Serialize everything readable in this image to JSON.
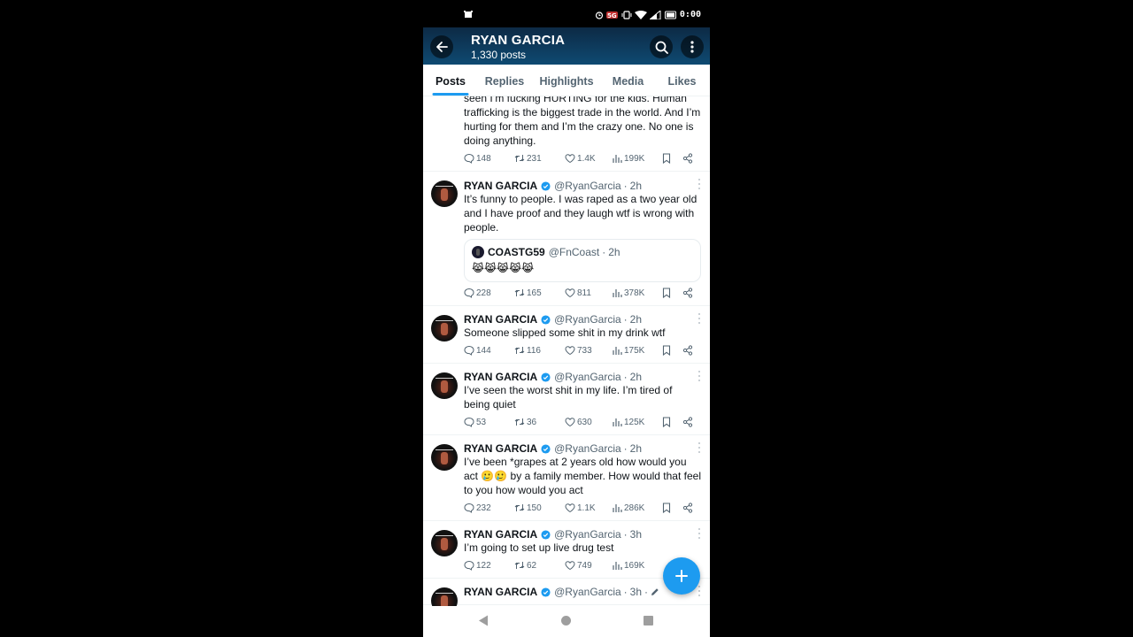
{
  "status_bar": {
    "time": "0:00",
    "left_icon": "notification-icon",
    "right_icons": [
      "alarm-icon",
      "data-icon",
      "vibrate-icon",
      "wifi-icon",
      "signal-icon",
      "battery-icon"
    ]
  },
  "header": {
    "title": "RYAN GARCIA",
    "subtitle": "1,330 posts",
    "back_icon": "arrow-left-icon",
    "search_icon": "search-icon",
    "more_icon": "more-vertical-icon"
  },
  "tabs": [
    {
      "label": "Posts",
      "active": true
    },
    {
      "label": "Replies",
      "active": false
    },
    {
      "label": "Highlights",
      "active": false
    },
    {
      "label": "Media",
      "active": false
    },
    {
      "label": "Likes",
      "active": false
    }
  ],
  "colors": {
    "accent": "#1d9bf0",
    "text_primary": "#0f1419",
    "text_secondary": "#536471",
    "header_top": "#0d2a45",
    "header_bottom": "#0e4a72"
  },
  "tweets": [
    {
      "partial": true,
      "text": "seen I’m fucking HURTING for the kids. Human trafficking is the biggest trade in the world. And I’m hurting for them and I’m the crazy one. No one is doing anything.",
      "replies": "148",
      "retweets": "231",
      "likes": "1.4K",
      "views": "199K"
    },
    {
      "name": "RYAN GARCIA",
      "handle": "@RyanGarcia",
      "time": "2h",
      "text": "It’s funny to people. I was raped as a two year old and I have proof and they laugh wtf is wrong with people.",
      "quote": {
        "name": "COASTG59",
        "handle": "@FnCoast",
        "time": "2h",
        "text": "😹😹😹😹😹"
      },
      "replies": "228",
      "retweets": "165",
      "likes": "811",
      "views": "378K"
    },
    {
      "name": "RYAN GARCIA",
      "handle": "@RyanGarcia",
      "time": "2h",
      "text": "Someone slipped some shit in my drink wtf",
      "replies": "144",
      "retweets": "116",
      "likes": "733",
      "views": "175K"
    },
    {
      "name": "RYAN GARCIA",
      "handle": "@RyanGarcia",
      "time": "2h",
      "text": "I’ve seen the worst shit in my life. I’m tired of being quiet",
      "replies": "53",
      "retweets": "36",
      "likes": "630",
      "views": "125K"
    },
    {
      "name": "RYAN GARCIA",
      "handle": "@RyanGarcia",
      "time": "2h",
      "text": "I’ve been *grapes at 2 years old how would you act 🥲🥲 by a family member. How would that feel to you how would you act",
      "replies": "232",
      "retweets": "150",
      "likes": "1.1K",
      "views": "286K"
    },
    {
      "name": "RYAN GARCIA",
      "handle": "@RyanGarcia",
      "time": "3h",
      "text": "I’m going to set up live drug test",
      "replies": "122",
      "retweets": "62",
      "likes": "749",
      "views": "169K"
    },
    {
      "name": "RYAN GARCIA",
      "handle": "@RyanGarcia",
      "time": "3h",
      "edited": true
    }
  ],
  "fab": {
    "icon": "plus-icon"
  },
  "navbar": {
    "back": "nav-back-icon",
    "home": "nav-home-icon",
    "recents": "nav-recents-icon"
  }
}
